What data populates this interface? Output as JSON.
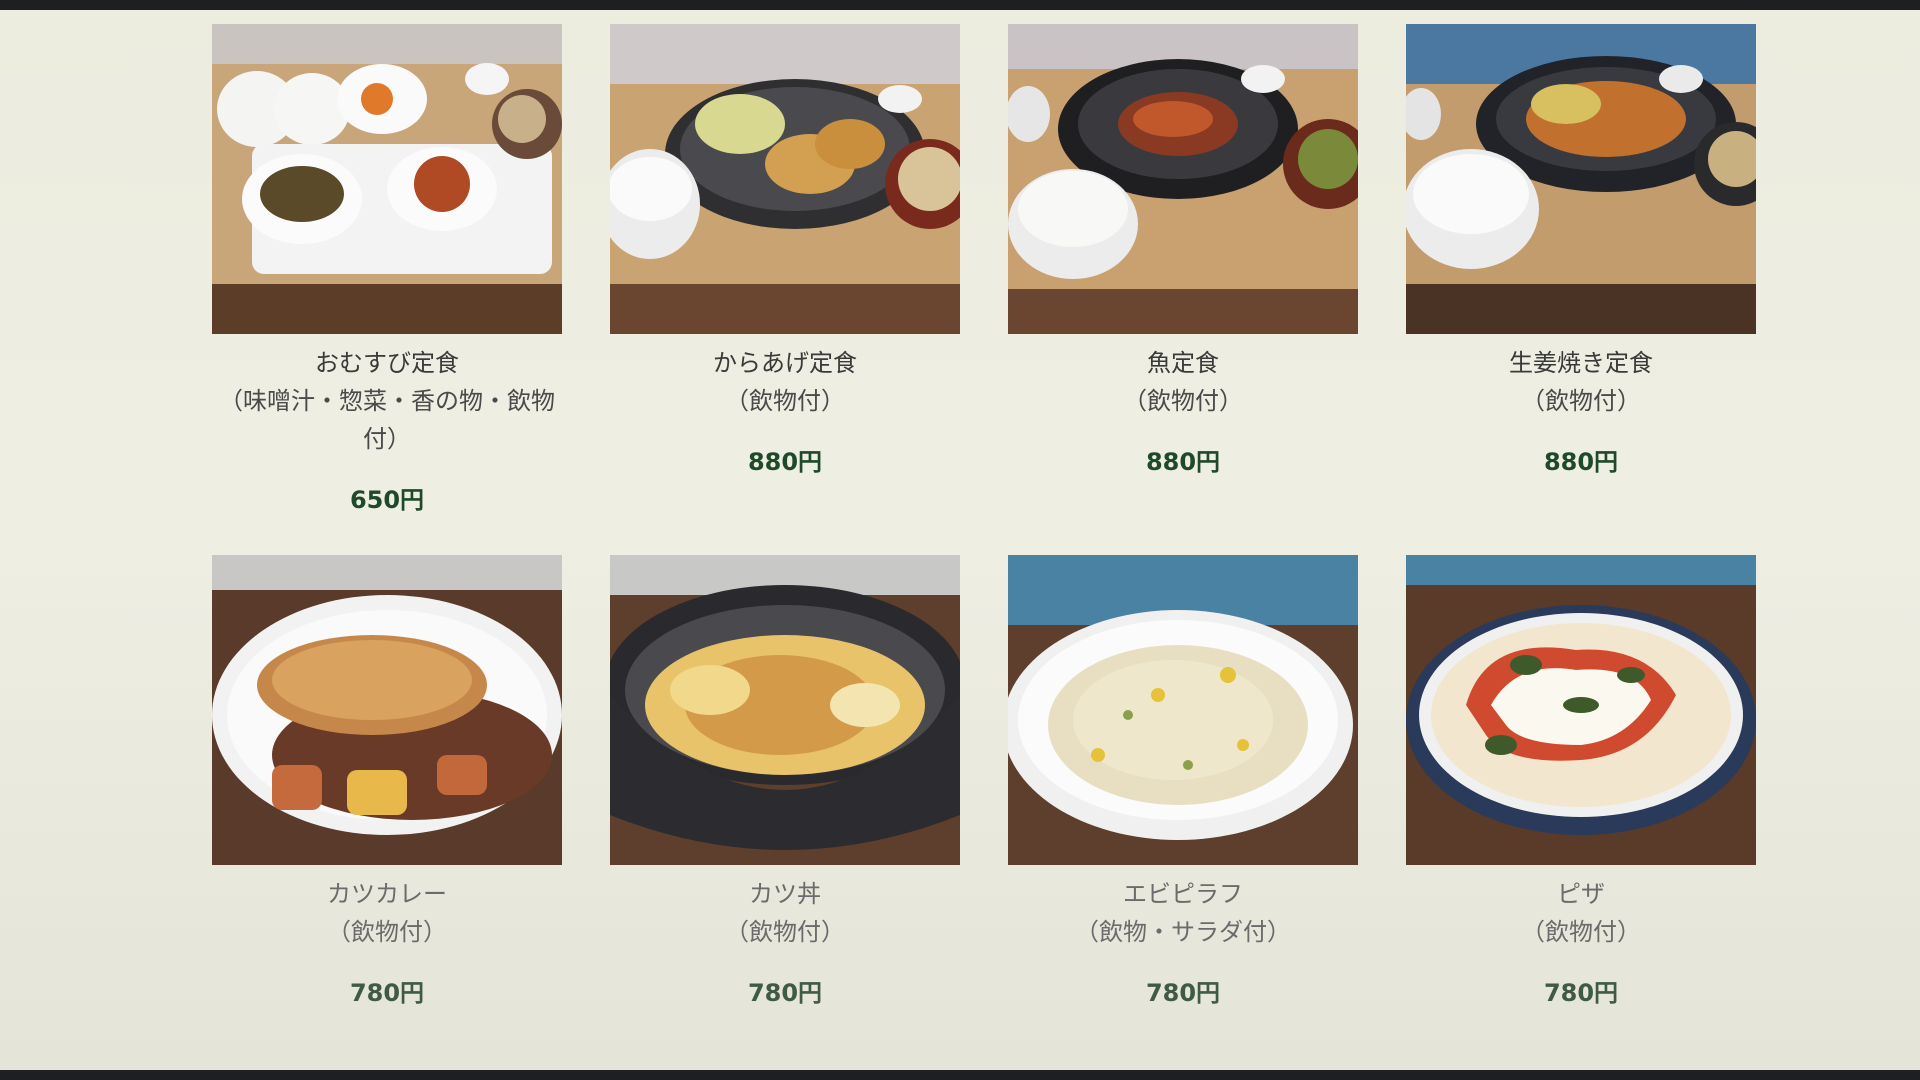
{
  "menu": {
    "items": [
      {
        "name": "おむすび定食",
        "note": "（味噌汁・惣菜・香の物・飲物付）",
        "price": "650円",
        "photo": "onigiri-set-photo"
      },
      {
        "name": "からあげ定食",
        "note": "（飲物付）",
        "price": "880円",
        "photo": "karaage-set-photo"
      },
      {
        "name": "魚定食",
        "note": "（飲物付）",
        "price": "880円",
        "photo": "fish-set-photo"
      },
      {
        "name": "生姜焼き定食",
        "note": "（飲物付）",
        "price": "880円",
        "photo": "ginger-pork-set-photo"
      },
      {
        "name": "カツカレー",
        "note": "（飲物付）",
        "price": "780円",
        "photo": "katsu-curry-photo"
      },
      {
        "name": "カツ丼",
        "note": "（飲物付）",
        "price": "780円",
        "photo": "katsudon-photo"
      },
      {
        "name": "エビピラフ",
        "note": "（飲物・サラダ付）",
        "price": "780円",
        "photo": "shrimp-pilaf-photo"
      },
      {
        "name": "ピザ",
        "note": "（飲物付）",
        "price": "780円",
        "photo": "pizza-photo"
      }
    ]
  }
}
